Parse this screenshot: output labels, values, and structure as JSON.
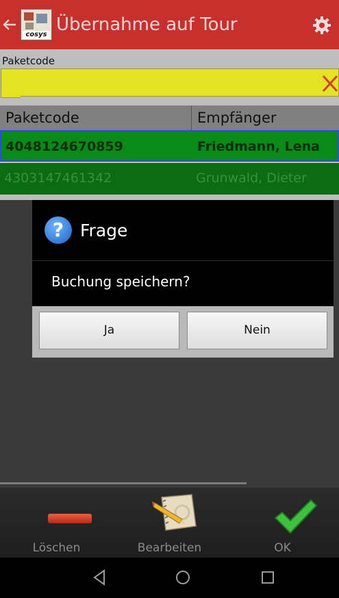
{
  "appbar": {
    "title": "Übernahme auf Tour",
    "logo_text": "cosys"
  },
  "form": {
    "label": "Paketcode",
    "input_value": ""
  },
  "table": {
    "headers": [
      "Paketcode",
      "Empfänger"
    ],
    "rows": [
      {
        "code": "4048124670859",
        "recipient": "Friedmann, Lena"
      },
      {
        "code": "4303147461342",
        "recipient": "Grunwald, Dieter"
      }
    ]
  },
  "dialog": {
    "title": "Frage",
    "message": "Buchung speichern?",
    "yes_label": "Ja",
    "no_label": "Nein"
  },
  "toolbar": {
    "delete_label": "Löschen",
    "edit_label": "Bearbeiten",
    "ok_label": "OK"
  },
  "colors": {
    "appbar": "#c8302e",
    "input": "#e6e324",
    "row_selected": "#0a8a18",
    "row": "#0b6c14"
  }
}
